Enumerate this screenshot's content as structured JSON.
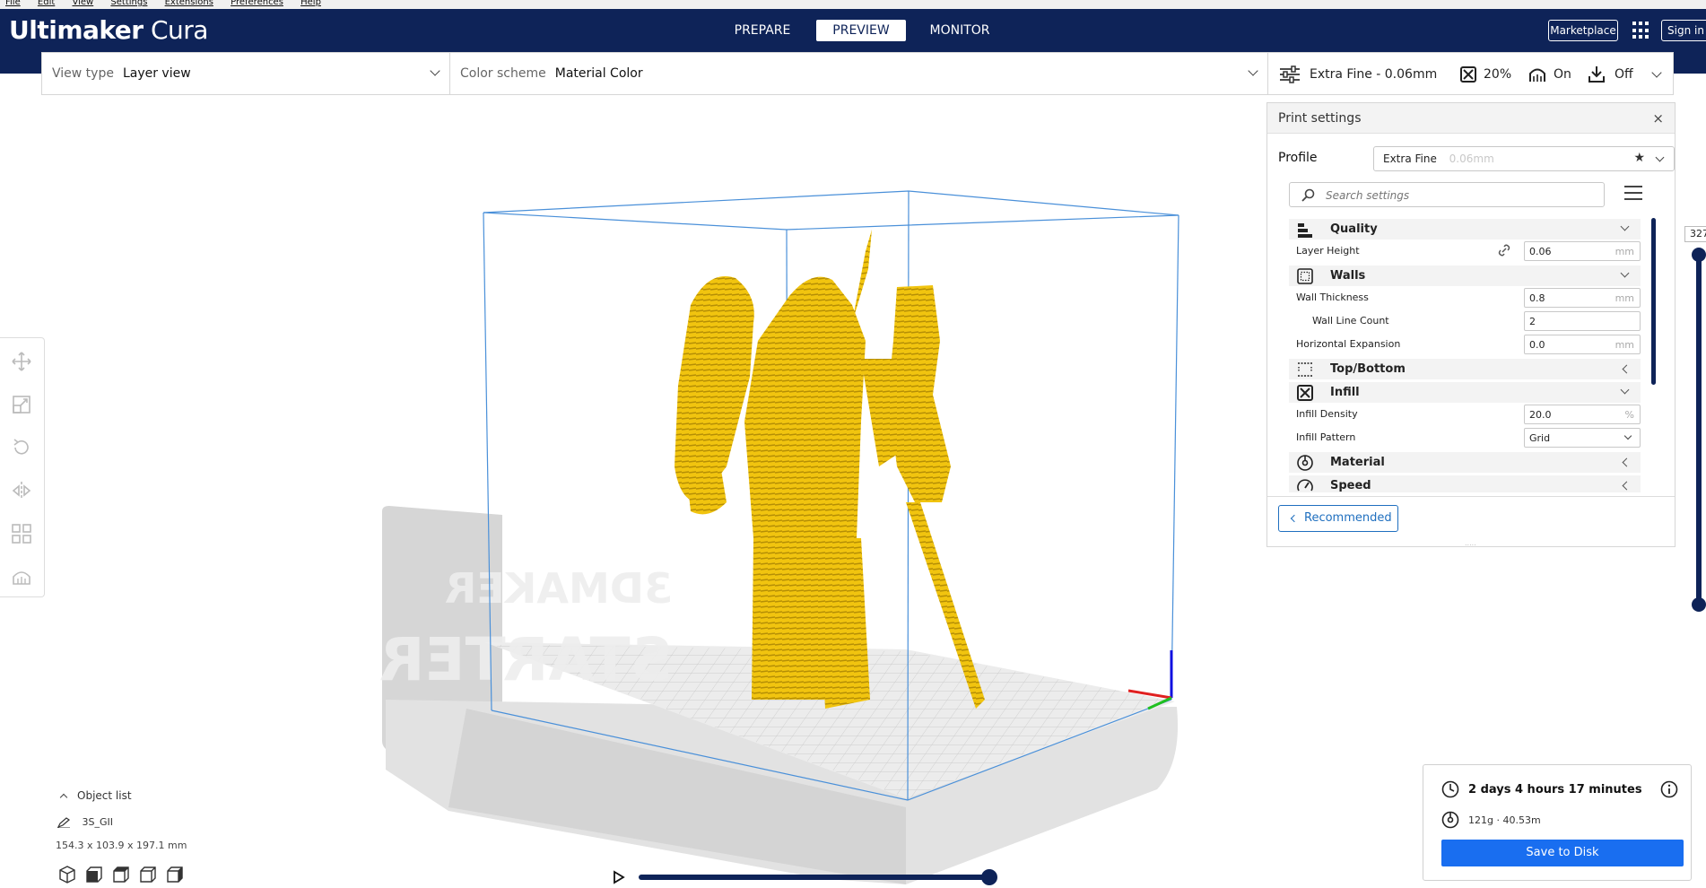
{
  "menu": [
    "File",
    "Edit",
    "View",
    "Settings",
    "Extensions",
    "Preferences",
    "Help"
  ],
  "header": {
    "logo_bold": "Ultimaker",
    "logo_light": " Cura",
    "stages": [
      "PREPARE",
      "PREVIEW",
      "MONITOR"
    ],
    "active_stage": "PREVIEW",
    "marketplace_label": "Marketplace",
    "signin_label": "Sign in"
  },
  "viewbar": {
    "view_type_label": "View type",
    "view_type_value": "Layer view",
    "color_scheme_label": "Color scheme",
    "color_scheme_value": "Material Color"
  },
  "printbar": {
    "profile": "Extra Fine - 0.06mm",
    "infill": "20%",
    "support": "On",
    "adhesion": "Off"
  },
  "settings_panel": {
    "title": "Print settings",
    "close": "×",
    "profile_label": "Profile",
    "profile_value": "Extra Fine",
    "profile_sub": "0.06mm",
    "search_placeholder": "Search settings",
    "categories": {
      "quality": "Quality",
      "walls": "Walls",
      "topbottom": "Top/Bottom",
      "infill": "Infill",
      "material": "Material",
      "speed": "Speed"
    },
    "settings": {
      "layer_height": {
        "label": "Layer Height",
        "value": "0.06",
        "unit": "mm"
      },
      "wall_thickness": {
        "label": "Wall Thickness",
        "value": "0.8",
        "unit": "mm"
      },
      "wall_line_count": {
        "label": "Wall Line Count",
        "value": "2"
      },
      "horizontal_expansion": {
        "label": "Horizontal Expansion",
        "value": "0.0",
        "unit": "mm"
      },
      "infill_density": {
        "label": "Infill Density",
        "value": "20.0",
        "unit": "%"
      },
      "infill_pattern": {
        "label": "Infill Pattern",
        "value": "Grid"
      }
    },
    "recommended_label": "Recommended",
    "grip": "....."
  },
  "layer_slider": {
    "current_layer": "327"
  },
  "object_list": {
    "toggle_label": "Object list",
    "object_name": "3S_GII",
    "dimensions": "154.3 x 103.9 x 197.1 mm"
  },
  "print_info": {
    "time": "2 days 4 hours 17 minutes",
    "material": "121g · 40.53m",
    "save_label": "Save to Disk"
  },
  "colors": {
    "header_bg": "#0e2358",
    "model_yellow": "#f2c40c",
    "save_button": "#196ef0",
    "build_volume_line": "#4a90d9"
  }
}
